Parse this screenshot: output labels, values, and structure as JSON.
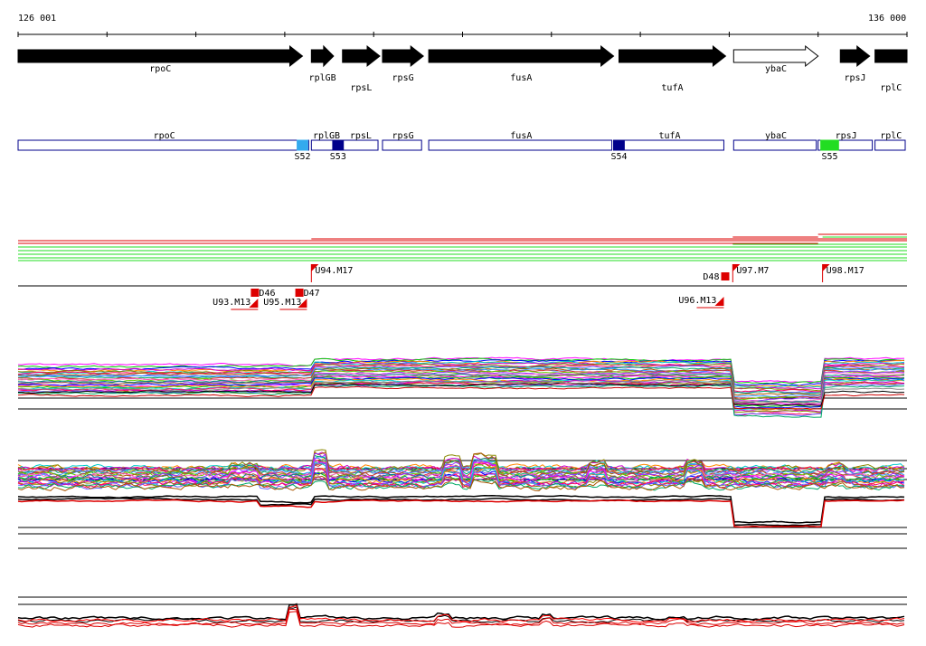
{
  "scale": {
    "start_label": "126 001",
    "end_label": "136 000",
    "start": 126001,
    "end": 136000
  },
  "genes": [
    {
      "name": "rpoC",
      "start": 126001,
      "end": 129200,
      "strand": "+",
      "fill": "black",
      "label_row": 1
    },
    {
      "name": "rplGB",
      "start": 129300,
      "end": 129550,
      "strand": "+",
      "fill": "black",
      "label_row": 2
    },
    {
      "name": "rpsL",
      "start": 129650,
      "end": 130070,
      "strand": "+",
      "fill": "black",
      "label_row": 3
    },
    {
      "name": "rpsG",
      "start": 130100,
      "end": 130560,
      "strand": "+",
      "fill": "black",
      "label_row": 2
    },
    {
      "name": "fusA",
      "start": 130620,
      "end": 132700,
      "strand": "+",
      "fill": "black",
      "label_row": 2
    },
    {
      "name": "tufA",
      "start": 132760,
      "end": 133960,
      "strand": "+",
      "fill": "black",
      "label_row": 3
    },
    {
      "name": "ybaC",
      "start": 134050,
      "end": 135000,
      "strand": "+",
      "fill": "white",
      "label_row": 1
    },
    {
      "name": "rpsJ",
      "start": 135250,
      "end": 135580,
      "strand": "+",
      "fill": "black",
      "label_row": 2
    },
    {
      "name": "rplC",
      "start": 135640,
      "end": 136000,
      "strand": "+",
      "fill": "black",
      "label_row": 3
    }
  ],
  "gene_boxes": [
    {
      "name": "rpoC",
      "start": 126001,
      "end": 129290
    },
    {
      "name": "rplGB",
      "start": 129300,
      "end": 129640
    },
    {
      "name": "rpsL",
      "start": 129640,
      "end": 130070
    },
    {
      "name": "rpsG",
      "start": 130100,
      "end": 130560
    },
    {
      "name": "fusA",
      "start": 130620,
      "end": 132700
    },
    {
      "name": "tufA",
      "start": 132700,
      "end": 133960
    },
    {
      "name": "ybaC",
      "start": 134050,
      "end": 135000
    },
    {
      "name": "rpsJ",
      "start": 135000,
      "end": 135630
    },
    {
      "name": "rplC",
      "start": 135640,
      "end": 136000
    }
  ],
  "sites": [
    {
      "label": "S52",
      "start": 129140,
      "end": 129260,
      "color": "#33aaee"
    },
    {
      "label": "S53",
      "start": 129540,
      "end": 129660,
      "color": "#00008b"
    },
    {
      "label": "S54",
      "start": 132700,
      "end": 132820,
      "color": "#00008b"
    },
    {
      "label": "S55",
      "start": 135030,
      "end": 135230,
      "color": "#22dd22"
    }
  ],
  "markers_upper": [
    {
      "label": "U94.M17",
      "pos": 129300
    },
    {
      "label": "U97.M7",
      "pos": 134040
    },
    {
      "label": "U98.M17",
      "pos": 135050
    }
  ],
  "markers_lower": [
    {
      "label": "U93.M13",
      "pos": 128700
    },
    {
      "label": "D46",
      "pos": 128650
    },
    {
      "label": "U95.M13",
      "pos": 129250
    },
    {
      "label": "D47",
      "pos": 129150
    },
    {
      "label": "D48",
      "pos": 133940
    },
    {
      "label": "U96.M13",
      "pos": 133940
    }
  ],
  "colors": {
    "red": "#dd0000",
    "green": "#22dd22",
    "box_border": "#00008b",
    "black": "#000000"
  }
}
